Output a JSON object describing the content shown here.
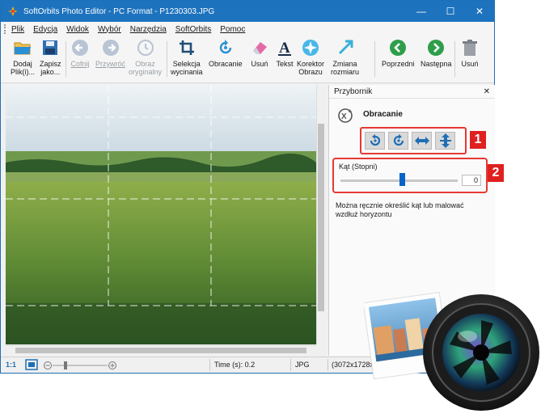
{
  "window": {
    "title": "SoftOrbits Photo Editor - PC Format - P1230303.JPG",
    "controls": [
      "—",
      "☐",
      "✕"
    ]
  },
  "menu": [
    "Plik",
    "Edycja",
    "Widok",
    "Wybór",
    "Narzędzia",
    "SoftOrbits",
    "Pomoc"
  ],
  "toolbar": {
    "add": [
      "Dodaj",
      "Plik(i)..."
    ],
    "save": [
      "Zapisz",
      "jako..."
    ],
    "undo": "Cofnij",
    "redo": "Przywróć",
    "original": [
      "Obraz",
      "oryginalny"
    ],
    "crop": [
      "Selekcja",
      "wycinania"
    ],
    "rotate": "Obracanie",
    "erase": "Usuń",
    "text": "Tekst",
    "corrector": [
      "Korektor",
      "Obrazu"
    ],
    "resize": [
      "Zmiana",
      "rozmiaru"
    ],
    "prev": "Poprzedni",
    "next": "Następna",
    "delete": "Usuń"
  },
  "panel": {
    "header": "Przybornik",
    "close": "✕",
    "title": "Obracanie",
    "badge1": "1",
    "badge2": "2",
    "angle_label": "Kąt (Stopni)",
    "angle_value": "0",
    "angle_level_fraction": 0.53,
    "hint": "Można ręcznie określić kąt lub malować wzdłuż horyzontu"
  },
  "status": {
    "zoom": "1:1",
    "time": "Time (s): 0.2",
    "format": "JPG",
    "dims": "(3072x1728x24"
  },
  "colors": {
    "titlebar": "#1e73be",
    "highlight": "#e53935",
    "slider": "#0a64c8"
  }
}
